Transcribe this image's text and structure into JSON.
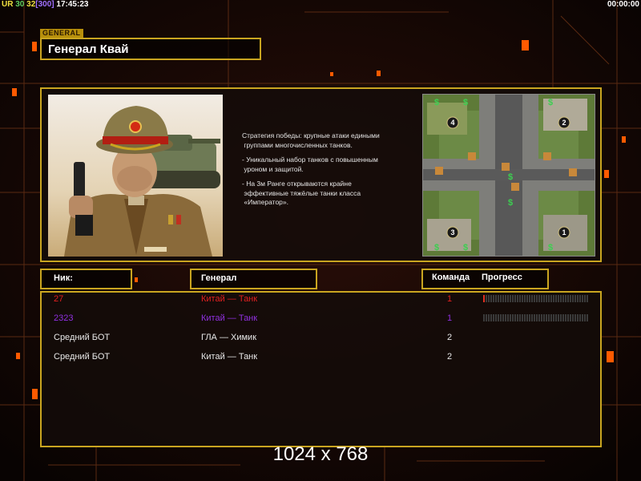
{
  "status": {
    "label": "UR",
    "val1": "30",
    "val2": "32",
    "val3": "[300]",
    "clock": "17:45:23",
    "timer": "00:00:00"
  },
  "general": {
    "tab_label": "GENERAL",
    "name": "Генерал Квай"
  },
  "description": [
    "Стратегия победы: крупные атаки едиными\n группами многочисленных танков.",
    "- Уникальный набор танков с повышенным\n уроном и защитой.",
    "- На 3м Ранге открываются крайне\n эффективные тяжёлые танки класса\n «Император»."
  ],
  "minimap": {
    "icons": [
      "money-icon",
      "factory-icon",
      "start-position-icon"
    ],
    "start_positions": [
      "1",
      "2",
      "3",
      "4"
    ]
  },
  "table": {
    "headers": {
      "nick": "Ник:",
      "general": "Генерал",
      "team": "Команда",
      "progress": "Прогресс"
    },
    "rows": [
      {
        "nick": "27",
        "general": "Китай — Танк",
        "team": "1",
        "color": "#e02020",
        "progress": 0.02
      },
      {
        "nick": "2323",
        "general": "Китай — Танк",
        "team": "1",
        "color": "#9030e0",
        "progress": 0.0
      },
      {
        "nick": "Средний БОТ",
        "general": "ГЛА — Химик",
        "team": "2",
        "color": "#e8e8e8"
      },
      {
        "nick": "Средний БОТ",
        "general": "Китай — Танк",
        "team": "2",
        "color": "#e8e8e8"
      }
    ]
  },
  "overlay": {
    "resolution": "1024 x 768"
  },
  "colors": {
    "accent": "#c9a520",
    "background": "#0d0605",
    "glow": "#ff5a00"
  }
}
